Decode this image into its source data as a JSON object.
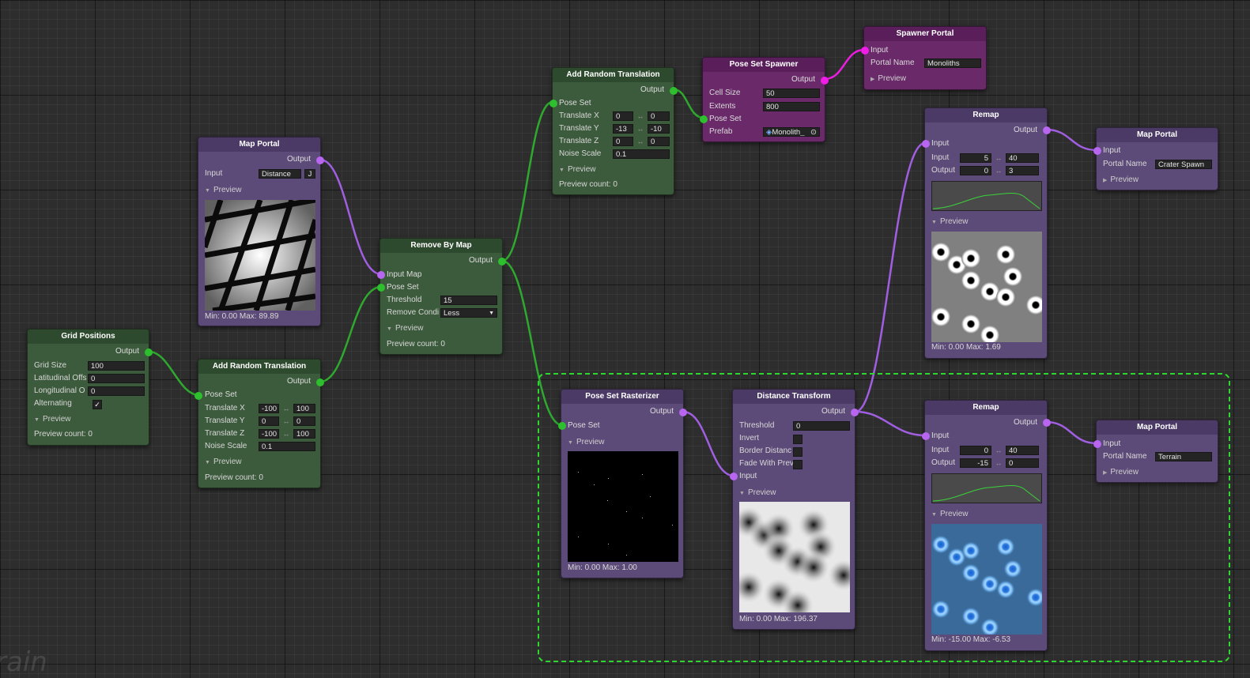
{
  "watermark": "rain",
  "colors": {
    "green_wire": "#2fa82f",
    "purple_wire": "#a05fe0",
    "magenta_wire": "#e81ee0",
    "selection": "#2fd62f"
  },
  "nodes": {
    "map_portal_1": {
      "title": "Map Portal",
      "output": "Output",
      "input_label": "Input",
      "input_value": "Distance",
      "btn": "J",
      "preview": "Preview",
      "stats": "Min: 0.00 Max: 89.89"
    },
    "grid_positions": {
      "title": "Grid Positions",
      "output": "Output",
      "grid_size_label": "Grid Size",
      "grid_size": "100",
      "lat_label": "Latitudinal Offs",
      "lat": "0",
      "lon_label": "Longitudinal O",
      "lon": "0",
      "alt_label": "Alternating",
      "alt_check": "✓",
      "preview": "Preview",
      "count": "Preview count: 0"
    },
    "art_1": {
      "title": "Add Random Translation",
      "output": "Output",
      "pose_set": "Pose Set",
      "tx_label": "Translate X",
      "tx_min": "-100",
      "tx_max": "100",
      "ty_label": "Translate Y",
      "ty_min": "0",
      "ty_max": "0",
      "tz_label": "Translate Z",
      "tz_min": "-100",
      "tz_max": "100",
      "noise_label": "Noise Scale",
      "noise": "0.1",
      "preview": "Preview",
      "count": "Preview count: 0"
    },
    "remove_by_map": {
      "title": "Remove By Map",
      "output": "Output",
      "input_map": "Input Map",
      "pose_set": "Pose Set",
      "threshold_label": "Threshold",
      "threshold": "15",
      "cond_label": "Remove Condi",
      "cond": "Less",
      "preview": "Preview",
      "count": "Preview count: 0"
    },
    "art_2": {
      "title": "Add Random Translation",
      "output": "Output",
      "pose_set": "Pose Set",
      "tx_label": "Translate X",
      "tx_min": "0",
      "tx_max": "0",
      "ty_label": "Translate Y",
      "ty_min": "-13",
      "ty_max": "-10",
      "tz_label": "Translate Z",
      "tz_min": "0",
      "tz_max": "0",
      "noise_label": "Noise Scale",
      "noise": "0.1",
      "preview": "Preview",
      "count": "Preview count: 0"
    },
    "pose_set_spawner": {
      "title": "Pose Set Spawner",
      "output": "Output",
      "cell_label": "Cell Size",
      "cell": "50",
      "ext_label": "Extents",
      "ext": "800",
      "pose_set": "Pose Set",
      "prefab_label": "Prefab",
      "prefab": "Monolith_"
    },
    "spawner_portal": {
      "title": "Spawner Portal",
      "input": "Input",
      "name_label": "Portal Name",
      "name": "Monoliths",
      "preview": "Preview"
    },
    "remap_1": {
      "title": "Remap",
      "output": "Output",
      "input": "Input",
      "in_label": "Input",
      "in_min": "5",
      "in_max": "40",
      "out_label": "Output",
      "out_min": "0",
      "out_max": "3",
      "preview": "Preview",
      "stats": "Min: 0.00 Max: 1.69"
    },
    "map_portal_2": {
      "title": "Map Portal",
      "input": "Input",
      "name_label": "Portal Name",
      "name": "Crater Spawn",
      "preview": "Preview"
    },
    "pose_set_rasterizer": {
      "title": "Pose Set Rasterizer",
      "output": "Output",
      "pose_set": "Pose Set",
      "preview": "Preview",
      "stats": "Min: 0.00 Max: 1.00"
    },
    "distance_transform": {
      "title": "Distance Transform",
      "output": "Output",
      "threshold_label": "Threshold",
      "threshold": "0",
      "invert_label": "Invert",
      "border_label": "Border Distanc",
      "fade_label": "Fade With Prev",
      "input": "Input",
      "preview": "Preview",
      "stats": "Min: 0.00 Max: 196.37"
    },
    "remap_2": {
      "title": "Remap",
      "output": "Output",
      "input": "Input",
      "in_label": "Input",
      "in_min": "0",
      "in_max": "40",
      "out_label": "Output",
      "out_min": "-15",
      "out_max": "0",
      "preview": "Preview",
      "stats": "Min: -15.00 Max: -6.53"
    },
    "map_portal_3": {
      "title": "Map Portal",
      "input": "Input",
      "name_label": "Portal Name",
      "name": "Terrain",
      "preview": "Preview"
    }
  }
}
